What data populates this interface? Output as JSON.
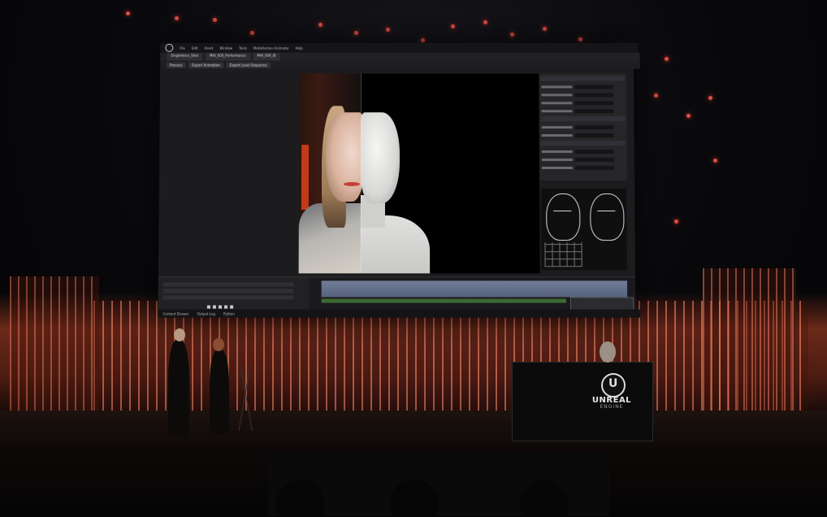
{
  "scene": {
    "description_type": "keynote stage photo with projected editor",
    "accent": "#ff5a4a",
    "wall_color": "#c25a3a"
  },
  "screen": {
    "menu": [
      "File",
      "Edit",
      "Asset",
      "Window",
      "Tools",
      "MetaHuman Animator",
      "Help"
    ],
    "tabs": [
      "SingleVoice_Shot",
      "MHI_000_Performance",
      "MHI_000_IB"
    ],
    "toolbar": [
      "Process",
      "Export Animation",
      "Export Level Sequence"
    ],
    "sequencer_bottom": [
      "Content Drawer",
      "Output Log",
      "Python"
    ],
    "icons": [
      "unreal-logo-icon",
      "play-icon",
      "stop-icon",
      "record-icon"
    ]
  },
  "podium": {
    "logo_word_1": "UNREAL",
    "logo_word_2": "ENGINE"
  }
}
